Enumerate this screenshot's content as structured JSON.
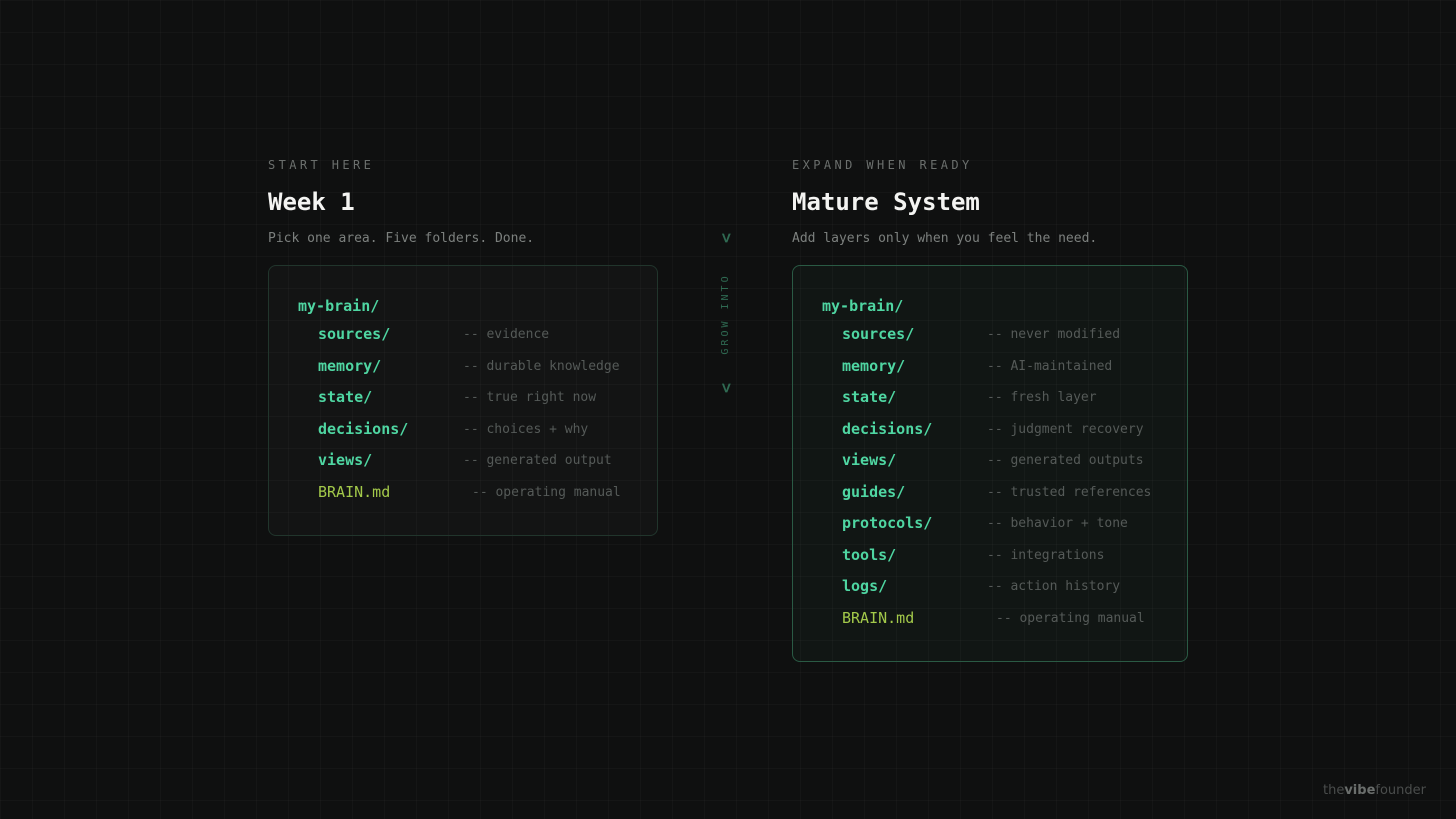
{
  "left": {
    "eyebrow": "START HERE",
    "title": "Week 1",
    "subtitle": "Pick one area. Five folders. Done.",
    "root": "my-brain/",
    "items": [
      {
        "name": "sources/",
        "comment": "-- evidence"
      },
      {
        "name": "memory/",
        "comment": "-- durable knowledge"
      },
      {
        "name": "state/",
        "comment": "-- true right now"
      },
      {
        "name": "decisions/",
        "comment": "-- choices + why"
      },
      {
        "name": "views/",
        "comment": "-- generated output"
      },
      {
        "name": "BRAIN.md",
        "comment": "-- operating manual"
      }
    ]
  },
  "divider": {
    "label": "GROW INTO",
    "arrow": ">"
  },
  "right": {
    "eyebrow": "EXPAND WHEN READY",
    "title": "Mature System",
    "subtitle": "Add layers only when you feel the need.",
    "root": "my-brain/",
    "items": [
      {
        "name": "sources/",
        "comment": "-- never modified"
      },
      {
        "name": "memory/",
        "comment": "-- AI-maintained"
      },
      {
        "name": "state/",
        "comment": "-- fresh layer"
      },
      {
        "name": "decisions/",
        "comment": "-- judgment recovery"
      },
      {
        "name": "views/",
        "comment": "-- generated outputs"
      },
      {
        "name": "guides/",
        "comment": "-- trusted references"
      },
      {
        "name": "protocols/",
        "comment": "-- behavior + tone"
      },
      {
        "name": "tools/",
        "comment": "-- integrations"
      },
      {
        "name": "logs/",
        "comment": "-- action history"
      },
      {
        "name": "BRAIN.md",
        "comment": "-- operating manual"
      }
    ]
  },
  "brand": {
    "prefix": "the",
    "strong": "vibe",
    "suffix": "founder"
  },
  "colors": {
    "background": "#0f1010",
    "folder": "#4fd6a2",
    "file": "#a3c94a",
    "comment": "#555a58",
    "accent_border": "#2a5a44"
  }
}
